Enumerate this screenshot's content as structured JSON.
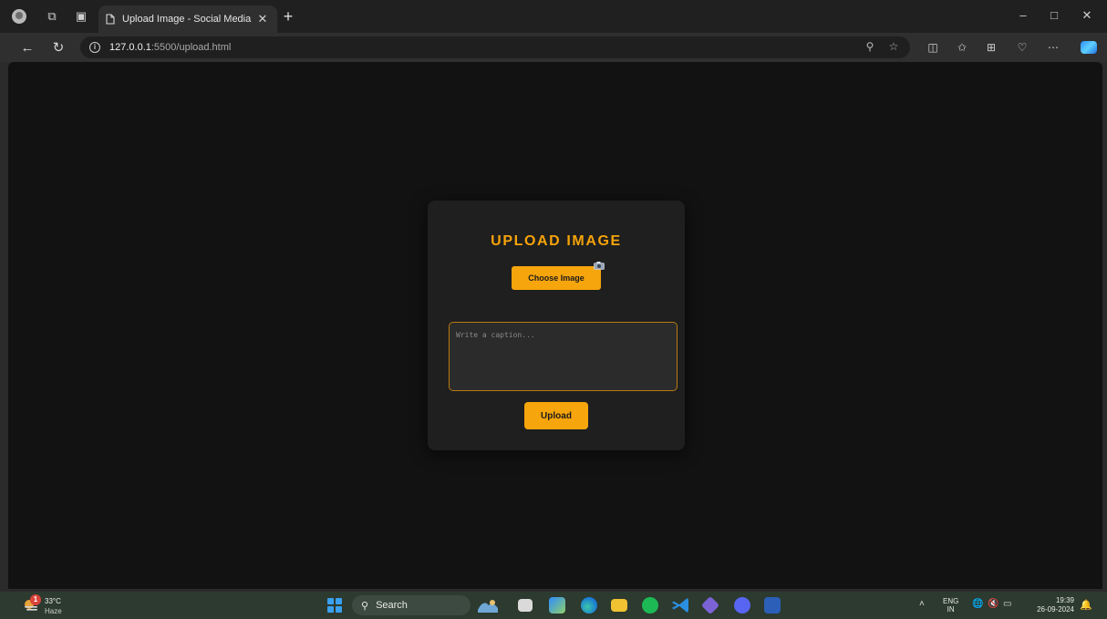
{
  "browser": {
    "tab_title": "Upload Image - Social Media",
    "url_host": "127.0.0.1",
    "url_path": ":5500/upload.html"
  },
  "page": {
    "heading": "UPLOAD IMAGE",
    "choose_label": "Choose Image",
    "caption_placeholder": "Write a caption...",
    "upload_label": "Upload",
    "accent_color": "#f7a50c"
  },
  "taskbar": {
    "weather_badge": "1",
    "temperature": "33°C",
    "condition": "Haze",
    "search_label": "Search",
    "lang_top": "ENG",
    "lang_bottom": "IN",
    "time": "19:39",
    "date": "26-09-2024"
  }
}
